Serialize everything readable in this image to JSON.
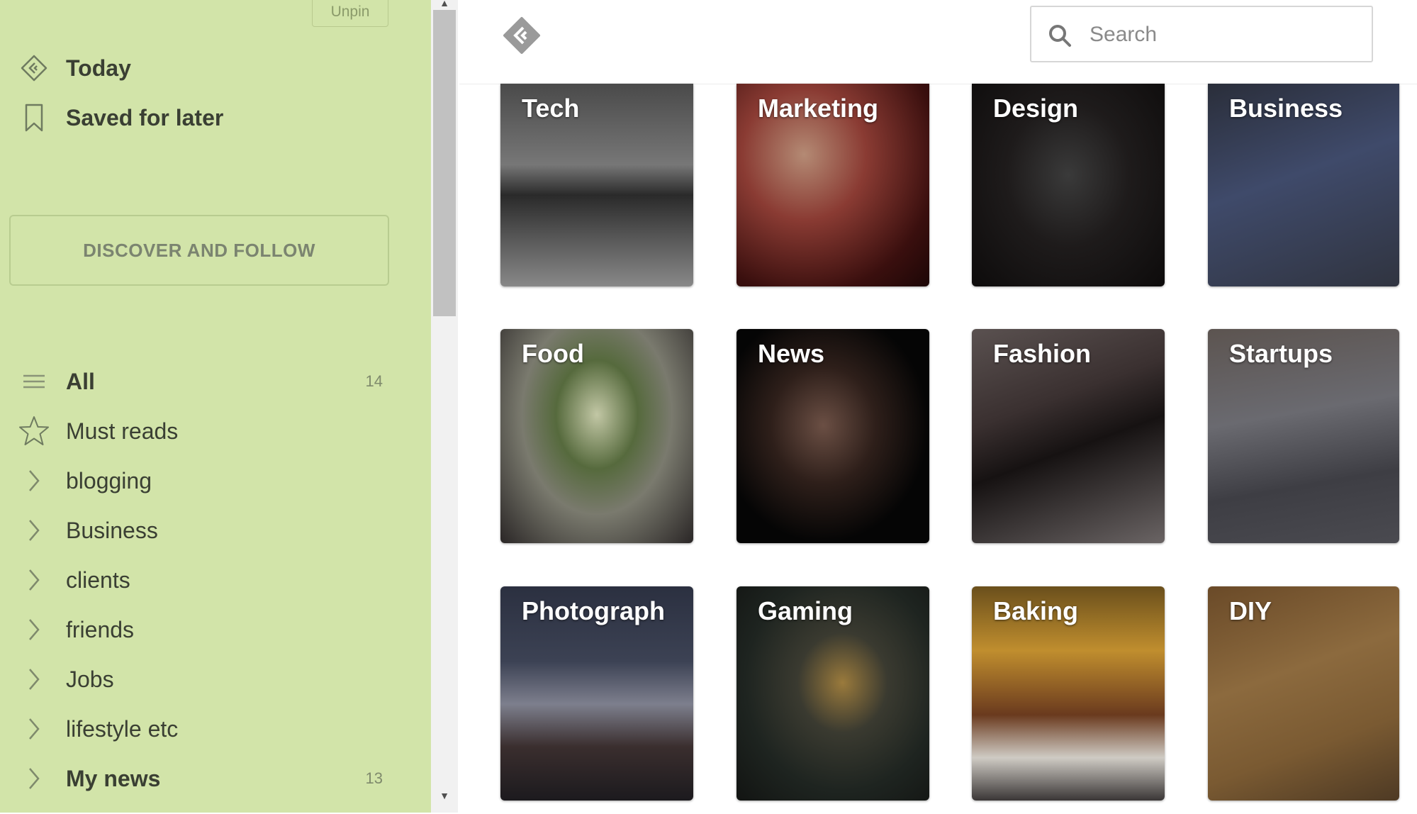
{
  "sidebar": {
    "unpin_label": "Unpin",
    "top_items": [
      {
        "label": "Today",
        "icon": "feedly-icon"
      },
      {
        "label": "Saved for later",
        "icon": "bookmark-icon"
      }
    ],
    "discover_label": "DISCOVER AND FOLLOW",
    "feeds": [
      {
        "label": "All",
        "icon": "menu-lines-icon",
        "count": "14",
        "bold": true
      },
      {
        "label": "Must reads",
        "icon": "star-icon",
        "count": "",
        "bold": false
      },
      {
        "label": "blogging",
        "icon": "chevron-right-icon",
        "count": "",
        "bold": false
      },
      {
        "label": "Business",
        "icon": "chevron-right-icon",
        "count": "",
        "bold": false
      },
      {
        "label": "clients",
        "icon": "chevron-right-icon",
        "count": "",
        "bold": false
      },
      {
        "label": "friends",
        "icon": "chevron-right-icon",
        "count": "",
        "bold": false
      },
      {
        "label": "Jobs",
        "icon": "chevron-right-icon",
        "count": "",
        "bold": false
      },
      {
        "label": "lifestyle etc",
        "icon": "chevron-right-icon",
        "count": "",
        "bold": false
      },
      {
        "label": "My news",
        "icon": "chevron-right-icon",
        "count": "13",
        "bold": true
      }
    ],
    "background_color": "#d2e4a9"
  },
  "header": {
    "search_placeholder": "Search"
  },
  "topics": [
    {
      "label": "Tech"
    },
    {
      "label": "Marketing"
    },
    {
      "label": "Design"
    },
    {
      "label": "Business"
    },
    {
      "label": "Food"
    },
    {
      "label": "News"
    },
    {
      "label": "Fashion"
    },
    {
      "label": "Startups"
    },
    {
      "label": "Photograph"
    },
    {
      "label": "Gaming"
    },
    {
      "label": "Baking"
    },
    {
      "label": "DIY"
    }
  ]
}
